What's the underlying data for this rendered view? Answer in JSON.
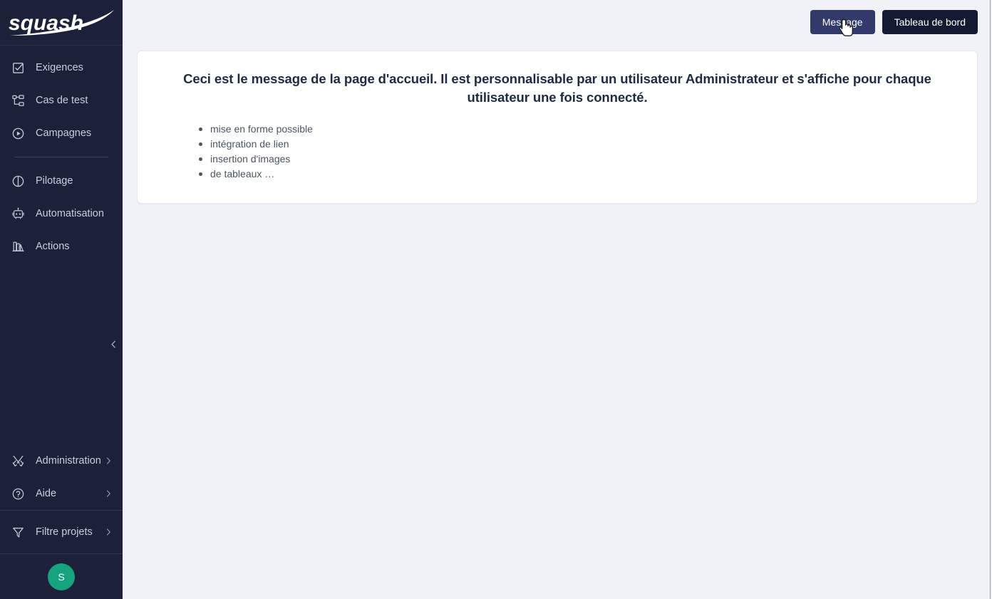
{
  "brand": {
    "name": "squash",
    "logo_icon": "squash-logo"
  },
  "sidebar": {
    "primary_items": [
      {
        "label": "Exigences",
        "icon": "checkbox-checked-icon"
      },
      {
        "label": "Cas de test",
        "icon": "tree-hierarchy-icon"
      },
      {
        "label": "Campagnes",
        "icon": "play-circle-icon"
      }
    ],
    "secondary_items": [
      {
        "label": "Pilotage",
        "icon": "pie-chart-icon"
      },
      {
        "label": "Automatisation",
        "icon": "robot-icon"
      },
      {
        "label": "Actions",
        "icon": "bookshelf-icon"
      }
    ],
    "footer_items": [
      {
        "label": "Administration",
        "icon": "tools-cross-icon",
        "chevron": "chevron-right-icon"
      },
      {
        "label": "Aide",
        "icon": "question-circle-icon",
        "chevron": "chevron-right-icon"
      }
    ],
    "filter_item": {
      "label": "Filtre projets",
      "icon": "funnel-icon",
      "chevron": "chevron-right-icon"
    },
    "collapse": {
      "icon": "chevron-left-icon"
    },
    "avatar": {
      "initial": "S",
      "color": "#15a47d"
    },
    "bg_color": "#1c2039"
  },
  "topbar": {
    "message_button": "Message",
    "dashboard_button": "Tableau de bord",
    "message_button_color": "#323a6b",
    "dashboard_button_color": "#151a33"
  },
  "main": {
    "card": {
      "title": "Ceci est le message de la page d'accueil. Il est personnalisable par un utilisateur Administrateur et s'affiche pour chaque utilisateur une fois connecté.",
      "bullets": [
        "mise en forme possible",
        "intégration de lien",
        "insertion d'images",
        "de tableaux …"
      ]
    },
    "background_color": "#f1f2f7"
  },
  "cursor": {
    "type": "pointer-hand-cursor"
  }
}
